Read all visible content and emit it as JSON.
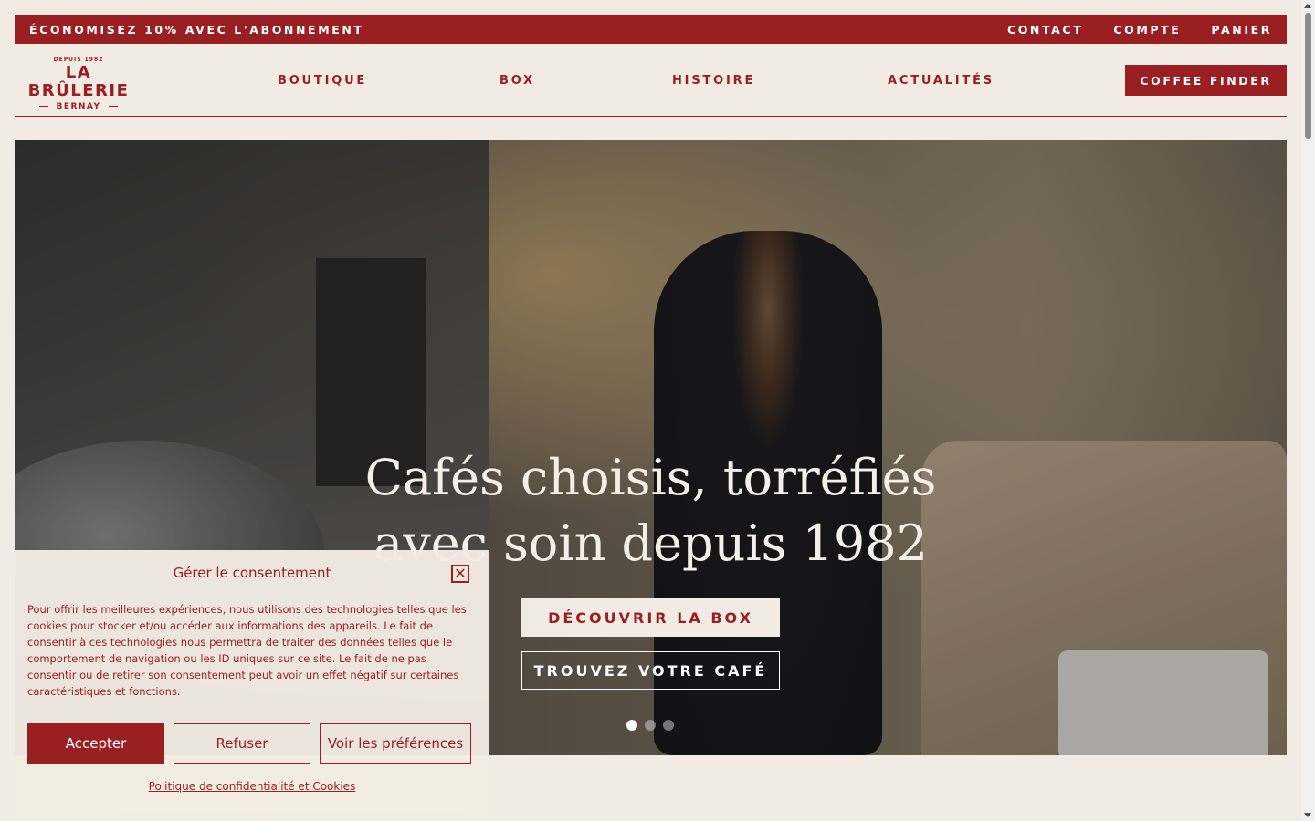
{
  "promo": {
    "text": "ÉCONOMISEZ 10% AVEC L'ABONNEMENT",
    "links": [
      "CONTACT",
      "COMPTE",
      "PANIER"
    ]
  },
  "logo": {
    "since": "DEPUIS 1982",
    "brand": "LA BRÛLERIE",
    "city": "BERNAY"
  },
  "nav": {
    "items": [
      "BOUTIQUE",
      "BOX",
      "HISTOIRE",
      "ACTUALITÉS"
    ],
    "finder": "COFFEE FINDER"
  },
  "hero": {
    "title_line1": "Cafés choisis, torréfiés",
    "title_line2": "avec soin depuis 1982",
    "cta_primary": "DÉCOUVRIR LA BOX",
    "cta_secondary": "TROUVEZ VOTRE CAFÉ",
    "slides_total": 3,
    "slide_active": 1
  },
  "consent": {
    "title": "Gérer le consentement",
    "message": "Pour offrir les meilleures expériences, nous utilisons des technologies telles que les cookies pour stocker et/ou accéder aux informations des appareils. Le fait de consentir à ces technologies nous permettra de traiter des données telles que le comportement de navigation ou les ID uniques sur ce site. Le fait de ne pas consentir ou de retirer son consentement peut avoir un effet négatif sur certaines caractéristiques et fonctions.",
    "accept": "Accepter",
    "refuse": "Refuser",
    "preferences": "Voir les préférences",
    "policy": "Politique de confidentialité et Cookies"
  },
  "colors": {
    "brand_red": "#9a1f22",
    "background": "#f2ebe3"
  }
}
